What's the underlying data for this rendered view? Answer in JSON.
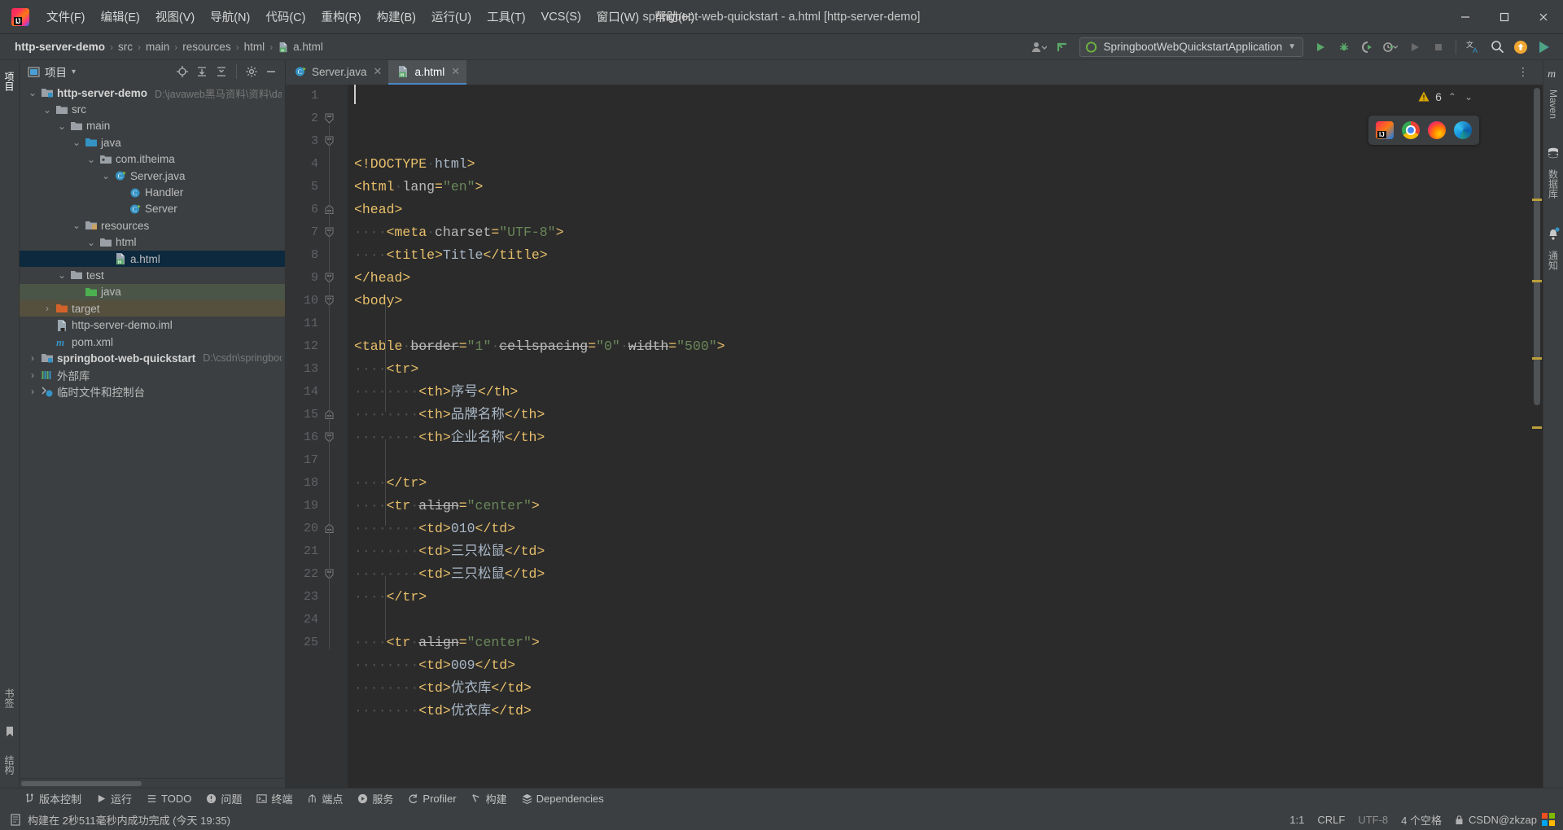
{
  "window": {
    "title": "springboot-web-quickstart - a.html [http-server-demo]",
    "minimize": "–",
    "maximize": "❐",
    "close": "✕"
  },
  "menu": {
    "items": [
      {
        "label": "文件(F)",
        "name": "menu-file"
      },
      {
        "label": "编辑(E)",
        "name": "menu-edit"
      },
      {
        "label": "视图(V)",
        "name": "menu-view"
      },
      {
        "label": "导航(N)",
        "name": "menu-navigate"
      },
      {
        "label": "代码(C)",
        "name": "menu-code"
      },
      {
        "label": "重构(R)",
        "name": "menu-refactor"
      },
      {
        "label": "构建(B)",
        "name": "menu-build"
      },
      {
        "label": "运行(U)",
        "name": "menu-run"
      },
      {
        "label": "工具(T)",
        "name": "menu-tools"
      },
      {
        "label": "VCS(S)",
        "name": "menu-vcs"
      },
      {
        "label": "窗口(W)",
        "name": "menu-window"
      },
      {
        "label": "帮助(H)",
        "name": "menu-help"
      }
    ]
  },
  "breadcrumb": {
    "items": [
      "http-server-demo",
      "src",
      "main",
      "resources",
      "html"
    ],
    "file": "a.html",
    "separator": "›"
  },
  "run_toolbar": {
    "configuration": "SpringbootWebQuickstartApplication",
    "dropdown_arrow": "▼",
    "buttons": [
      {
        "name": "run-button",
        "title": "运行"
      },
      {
        "name": "debug-button",
        "title": "调试"
      },
      {
        "name": "run-with-coverage-button",
        "title": "覆盖率运行"
      },
      {
        "name": "profiler-button",
        "title": "性能分析"
      },
      {
        "name": "rerun-button",
        "title": "重新运行"
      },
      {
        "name": "stop-button",
        "title": "停止"
      },
      {
        "name": "translate-icon",
        "title": "翻译"
      },
      {
        "name": "search-everywhere-icon",
        "title": "搜索"
      },
      {
        "name": "update-icon",
        "title": "更新"
      },
      {
        "name": "ai-assistant-icon",
        "title": "AI 助手"
      }
    ]
  },
  "project_panel": {
    "title": "项目",
    "dropdown_arrow": "▾",
    "header_icons": [
      "locate-icon",
      "expand-all-icon",
      "collapse-all-icon",
      "settings-icon",
      "hide-icon",
      "refresh-icon"
    ],
    "tree": [
      {
        "label": "http-server-demo",
        "path": "D:\\javaweb黑马资料\\资料\\day",
        "indent": 0,
        "arrow": "⌄",
        "icon": "module-folder-icon",
        "bold": true,
        "state": "none"
      },
      {
        "label": "src",
        "path": "",
        "indent": 1,
        "arrow": "⌄",
        "icon": "folder-icon",
        "bold": false,
        "state": "none"
      },
      {
        "label": "main",
        "path": "",
        "indent": 2,
        "arrow": "⌄",
        "icon": "folder-icon",
        "bold": false,
        "state": "none"
      },
      {
        "label": "java",
        "path": "",
        "indent": 3,
        "arrow": "⌄",
        "icon": "source-folder-icon",
        "bold": false,
        "state": "none"
      },
      {
        "label": "com.itheima",
        "path": "",
        "indent": 4,
        "arrow": "⌄",
        "icon": "package-icon",
        "bold": false,
        "state": "none"
      },
      {
        "label": "Server.java",
        "path": "",
        "indent": 5,
        "arrow": "⌄",
        "icon": "java-class-runnable-icon",
        "bold": false,
        "state": "none"
      },
      {
        "label": "Handler",
        "path": "",
        "indent": 6,
        "arrow": "",
        "icon": "class-icon",
        "bold": false,
        "state": "none"
      },
      {
        "label": "Server",
        "path": "",
        "indent": 6,
        "arrow": "",
        "icon": "java-class-runnable-icon",
        "bold": false,
        "state": "none"
      },
      {
        "label": "resources",
        "path": "",
        "indent": 3,
        "arrow": "⌄",
        "icon": "resource-folder-icon",
        "bold": false,
        "state": "none"
      },
      {
        "label": "html",
        "path": "",
        "indent": 4,
        "arrow": "⌄",
        "icon": "folder-icon",
        "bold": false,
        "state": "none"
      },
      {
        "label": "a.html",
        "path": "",
        "indent": 5,
        "arrow": "",
        "icon": "html-file-icon",
        "bold": false,
        "state": "selected"
      },
      {
        "label": "test",
        "path": "",
        "indent": 2,
        "arrow": "⌄",
        "icon": "folder-icon",
        "bold": false,
        "state": "none"
      },
      {
        "label": "java",
        "path": "",
        "indent": 3,
        "arrow": "",
        "icon": "test-source-folder-icon",
        "bold": false,
        "state": "green"
      },
      {
        "label": "target",
        "path": "",
        "indent": 1,
        "arrow": "›",
        "icon": "excluded-folder-icon",
        "bold": false,
        "state": "brown"
      },
      {
        "label": "http-server-demo.iml",
        "path": "",
        "indent": 1,
        "arrow": "",
        "icon": "iml-file-icon",
        "bold": false,
        "state": "none"
      },
      {
        "label": "pom.xml",
        "path": "",
        "indent": 1,
        "arrow": "",
        "icon": "maven-file-icon",
        "bold": false,
        "state": "none"
      },
      {
        "label": "springboot-web-quickstart",
        "path": "D:\\csdn\\springboo",
        "indent": 0,
        "arrow": "›",
        "icon": "module-folder-icon",
        "bold": true,
        "state": "none"
      },
      {
        "label": "外部库",
        "path": "",
        "indent": 0,
        "arrow": "›",
        "icon": "library-icon",
        "bold": false,
        "state": "none"
      },
      {
        "label": "临时文件和控制台",
        "path": "",
        "indent": 0,
        "arrow": "›",
        "icon": "scratches-icon",
        "bold": false,
        "state": "none"
      }
    ]
  },
  "left_strip": {
    "tabs": [
      "项目"
    ],
    "bottom": [
      "书签",
      "结构"
    ]
  },
  "right_strip": {
    "tabs": [
      "Maven",
      "数据库",
      "通知"
    ]
  },
  "editor_tabs": [
    {
      "label": "Server.java",
      "icon": "java-class-runnable-icon",
      "active": false,
      "close": "✕"
    },
    {
      "label": "a.html",
      "icon": "html-file-icon",
      "active": true,
      "close": "✕"
    }
  ],
  "inspection_widget": {
    "warning_icon": "warning-triangle-icon",
    "count": "6",
    "up": "⌃",
    "down": "⌄"
  },
  "browser_popup": {
    "browsers": [
      "intellij-idea-icon",
      "chrome-icon",
      "firefox-icon",
      "edge-icon"
    ]
  },
  "code": {
    "language": "html",
    "caret_position": "1:1",
    "lines": [
      {
        "num": 1,
        "fold": "",
        "indent": 0,
        "tokens": [
          {
            "t": "tag",
            "v": "<!DOCTYPE"
          },
          {
            "t": "sp",
            "v": " "
          },
          {
            "t": "txt",
            "v": "html"
          },
          {
            "t": "tag",
            "v": ">"
          }
        ]
      },
      {
        "num": 2,
        "fold": "start",
        "indent": 0,
        "tokens": [
          {
            "t": "tag",
            "v": "<html"
          },
          {
            "t": "sp",
            "v": " "
          },
          {
            "t": "attr-ok",
            "v": "lang"
          },
          {
            "t": "tag",
            "v": "="
          },
          {
            "t": "str",
            "v": "\"en\""
          },
          {
            "t": "tag",
            "v": ">"
          }
        ]
      },
      {
        "num": 3,
        "fold": "start",
        "indent": 0,
        "tokens": [
          {
            "t": "tag",
            "v": "<head>"
          }
        ]
      },
      {
        "num": 4,
        "fold": "",
        "indent": 1,
        "tokens": [
          {
            "t": "tag",
            "v": "<meta"
          },
          {
            "t": "sp",
            "v": " "
          },
          {
            "t": "attr-ok",
            "v": "charset"
          },
          {
            "t": "tag",
            "v": "="
          },
          {
            "t": "str",
            "v": "\"UTF-8\""
          },
          {
            "t": "tag",
            "v": ">"
          }
        ]
      },
      {
        "num": 5,
        "fold": "",
        "indent": 1,
        "tokens": [
          {
            "t": "tag",
            "v": "<title>"
          },
          {
            "t": "txt",
            "v": "Title"
          },
          {
            "t": "tag",
            "v": "</title>"
          }
        ]
      },
      {
        "num": 6,
        "fold": "end",
        "indent": 0,
        "tokens": [
          {
            "t": "tag",
            "v": "</head>"
          }
        ]
      },
      {
        "num": 7,
        "fold": "start",
        "indent": 0,
        "tokens": [
          {
            "t": "tag",
            "v": "<body>"
          }
        ]
      },
      {
        "num": 8,
        "fold": "",
        "indent": 0,
        "tokens": []
      },
      {
        "num": 9,
        "fold": "start",
        "indent": 0,
        "tokens": [
          {
            "t": "tag",
            "v": "<table"
          },
          {
            "t": "sp",
            "v": " "
          },
          {
            "t": "attr",
            "v": "border"
          },
          {
            "t": "tag",
            "v": "="
          },
          {
            "t": "str",
            "v": "\"1\""
          },
          {
            "t": "sp",
            "v": " "
          },
          {
            "t": "attr",
            "v": "cellspacing"
          },
          {
            "t": "tag",
            "v": "="
          },
          {
            "t": "str",
            "v": "\"0\""
          },
          {
            "t": "sp",
            "v": " "
          },
          {
            "t": "attr",
            "v": "width"
          },
          {
            "t": "tag",
            "v": "="
          },
          {
            "t": "str",
            "v": "\"500\""
          },
          {
            "t": "tag",
            "v": ">"
          }
        ]
      },
      {
        "num": 10,
        "fold": "start",
        "indent": 1,
        "tokens": [
          {
            "t": "tag",
            "v": "<tr>"
          }
        ]
      },
      {
        "num": 11,
        "fold": "",
        "indent": 2,
        "tokens": [
          {
            "t": "tag",
            "v": "<th>"
          },
          {
            "t": "txt",
            "v": "序号"
          },
          {
            "t": "tag",
            "v": "</th>"
          }
        ]
      },
      {
        "num": 12,
        "fold": "",
        "indent": 2,
        "tokens": [
          {
            "t": "tag",
            "v": "<th>"
          },
          {
            "t": "txt",
            "v": "品牌名称"
          },
          {
            "t": "tag",
            "v": "</th>"
          }
        ]
      },
      {
        "num": 13,
        "fold": "",
        "indent": 2,
        "tokens": [
          {
            "t": "tag",
            "v": "<th>"
          },
          {
            "t": "txt",
            "v": "企业名称"
          },
          {
            "t": "tag",
            "v": "</th>"
          }
        ]
      },
      {
        "num": 14,
        "fold": "",
        "indent": 0,
        "tokens": []
      },
      {
        "num": 15,
        "fold": "end",
        "indent": 1,
        "tokens": [
          {
            "t": "tag",
            "v": "</tr>"
          }
        ]
      },
      {
        "num": 16,
        "fold": "start",
        "indent": 1,
        "tokens": [
          {
            "t": "tag",
            "v": "<tr"
          },
          {
            "t": "sp",
            "v": " "
          },
          {
            "t": "attr",
            "v": "align"
          },
          {
            "t": "tag",
            "v": "="
          },
          {
            "t": "str",
            "v": "\"center\""
          },
          {
            "t": "tag",
            "v": ">"
          }
        ]
      },
      {
        "num": 17,
        "fold": "",
        "indent": 2,
        "tokens": [
          {
            "t": "tag",
            "v": "<td>"
          },
          {
            "t": "txt",
            "v": "010"
          },
          {
            "t": "tag",
            "v": "</td>"
          }
        ]
      },
      {
        "num": 18,
        "fold": "",
        "indent": 2,
        "tokens": [
          {
            "t": "tag",
            "v": "<td>"
          },
          {
            "t": "txt",
            "v": "三只松鼠"
          },
          {
            "t": "tag",
            "v": "</td>"
          }
        ]
      },
      {
        "num": 19,
        "fold": "",
        "indent": 2,
        "tokens": [
          {
            "t": "tag",
            "v": "<td>"
          },
          {
            "t": "txt",
            "v": "三只松鼠"
          },
          {
            "t": "tag",
            "v": "</td>"
          }
        ]
      },
      {
        "num": 20,
        "fold": "end",
        "indent": 1,
        "tokens": [
          {
            "t": "tag",
            "v": "</tr>"
          }
        ]
      },
      {
        "num": 21,
        "fold": "",
        "indent": 0,
        "tokens": []
      },
      {
        "num": 22,
        "fold": "start",
        "indent": 1,
        "tokens": [
          {
            "t": "tag",
            "v": "<tr"
          },
          {
            "t": "sp",
            "v": " "
          },
          {
            "t": "attr",
            "v": "align"
          },
          {
            "t": "tag",
            "v": "="
          },
          {
            "t": "str",
            "v": "\"center\""
          },
          {
            "t": "tag",
            "v": ">"
          }
        ]
      },
      {
        "num": 23,
        "fold": "",
        "indent": 2,
        "tokens": [
          {
            "t": "tag",
            "v": "<td>"
          },
          {
            "t": "txt",
            "v": "009"
          },
          {
            "t": "tag",
            "v": "</td>"
          }
        ]
      },
      {
        "num": 24,
        "fold": "",
        "indent": 2,
        "tokens": [
          {
            "t": "tag",
            "v": "<td>"
          },
          {
            "t": "txt",
            "v": "优衣库"
          },
          {
            "t": "tag",
            "v": "</td>"
          }
        ]
      },
      {
        "num": 25,
        "fold": "",
        "indent": 2,
        "tokens": [
          {
            "t": "tag",
            "v": "<td>"
          },
          {
            "t": "txt",
            "v": "优衣库"
          },
          {
            "t": "tag",
            "v": "</td>"
          }
        ]
      }
    ]
  },
  "tool_windows": [
    {
      "label": "版本控制",
      "icon": "vcs-icon"
    },
    {
      "label": "运行",
      "icon": "run-icon"
    },
    {
      "label": "TODO",
      "icon": "todo-icon"
    },
    {
      "label": "问题",
      "icon": "problems-icon"
    },
    {
      "label": "终端",
      "icon": "terminal-icon"
    },
    {
      "label": "端点",
      "icon": "endpoints-icon"
    },
    {
      "label": "服务",
      "icon": "services-icon"
    },
    {
      "label": "Profiler",
      "icon": "profiler-icon"
    },
    {
      "label": "构建",
      "icon": "build-icon"
    },
    {
      "label": "Dependencies",
      "icon": "dependencies-icon"
    }
  ],
  "status_bar": {
    "message_icon": "build-status-icon",
    "message": "构建在 2秒511毫秒内成功完成 (今天 19:35)",
    "caret": "1:1",
    "line_separator": "CRLF",
    "encoding": "UTF-8",
    "indent": "4 个空格",
    "branch": "CSDN@zkzap",
    "lock_icon": "lock-icon"
  },
  "colors": {
    "accent_blue": "#4a88c7",
    "tag": "#e8bf6a",
    "string": "#6a8759",
    "selection": "#0d293e",
    "warning": "#d9a700"
  }
}
